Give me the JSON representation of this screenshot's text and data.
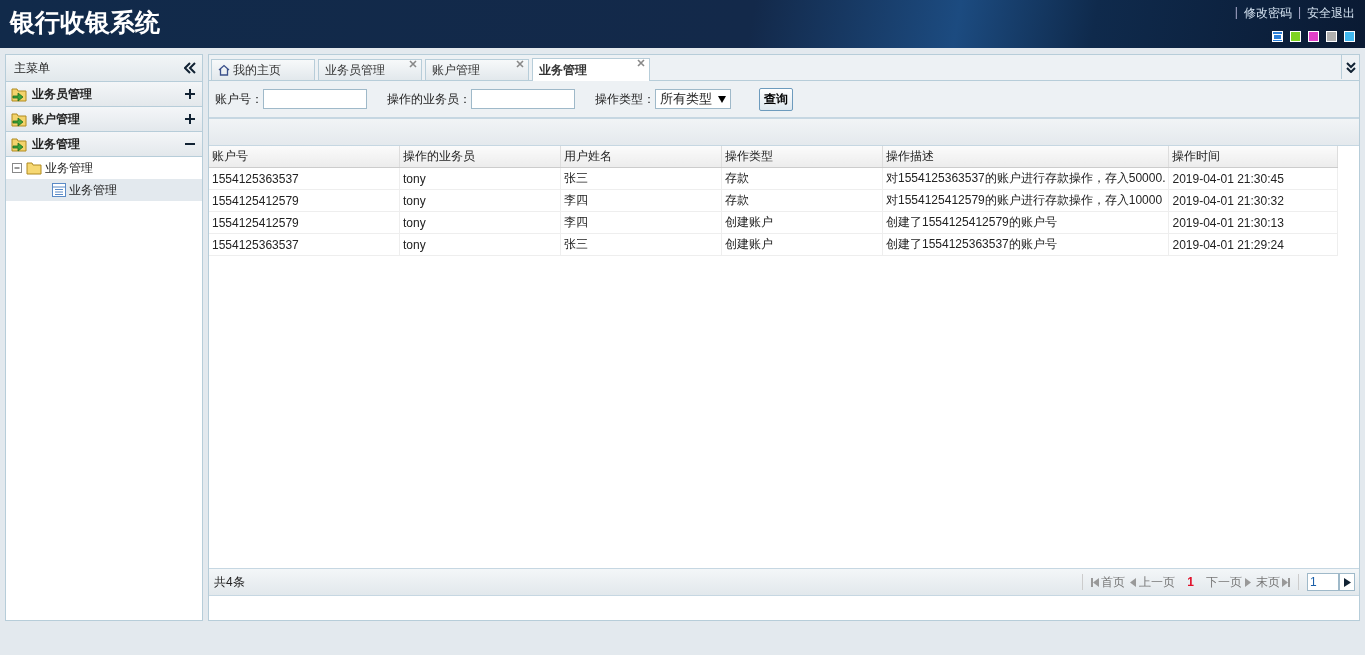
{
  "header": {
    "title": "银行收银系统",
    "links": [
      {
        "separator": "|",
        "label": "修改密码"
      },
      {
        "separator": "|",
        "label": "安全退出"
      }
    ],
    "themes": [
      {
        "color": "#2b7fd8",
        "selected": true
      },
      {
        "color": "#7ed321",
        "selected": false
      },
      {
        "color": "#e040c8",
        "selected": false
      },
      {
        "color": "#b0b0b0",
        "selected": false
      },
      {
        "color": "#40b8f0",
        "selected": false
      }
    ]
  },
  "sidebar": {
    "title": "主菜单",
    "sections": [
      {
        "label": "业务员管理",
        "expanded": false
      },
      {
        "label": "账户管理",
        "expanded": false
      },
      {
        "label": "业务管理",
        "expanded": true,
        "tree": [
          {
            "label": "业务管理",
            "expanded": true,
            "selected": false,
            "children": [
              {
                "label": "业务管理",
                "selected": true
              }
            ]
          }
        ]
      }
    ]
  },
  "tabs": [
    {
      "label": "我的主页",
      "selected": false,
      "closable": false
    },
    {
      "label": "业务员管理",
      "selected": false,
      "closable": true
    },
    {
      "label": "账户管理",
      "selected": false,
      "closable": true
    },
    {
      "label": "业务管理",
      "selected": true,
      "closable": true
    }
  ],
  "search": {
    "fields": [
      {
        "label": "账户号：",
        "kind": "text"
      },
      {
        "label": "操作的业务员：",
        "kind": "text"
      },
      {
        "label": "操作类型：",
        "kind": "select",
        "value": "所有类型"
      }
    ],
    "button": "查询"
  },
  "table": {
    "columns": [
      "账户号",
      "操作的业务员",
      "用户姓名",
      "操作类型",
      "操作描述",
      "操作时间"
    ],
    "rows": [
      [
        "1554125363537",
        "tony",
        "张三",
        "存款",
        "对1554125363537的账户进行存款操作，存入50000.",
        "2019-04-01 21:30:45"
      ],
      [
        "1554125412579",
        "tony",
        "李四",
        "存款",
        "对1554125412579的账户进行存款操作，存入10000",
        "2019-04-01 21:30:32"
      ],
      [
        "1554125412579",
        "tony",
        "李四",
        "创建账户",
        "创建了1554125412579的账户号",
        "2019-04-01 21:30:13"
      ],
      [
        "1554125363537",
        "tony",
        "张三",
        "创建账户",
        "创建了1554125363537的账户号",
        "2019-04-01 21:29:24"
      ]
    ]
  },
  "pager": {
    "total": "共4条",
    "first": "首页",
    "prev": "上一页",
    "current": "1",
    "next": "下一页",
    "last": "末页",
    "page_input": "1"
  }
}
